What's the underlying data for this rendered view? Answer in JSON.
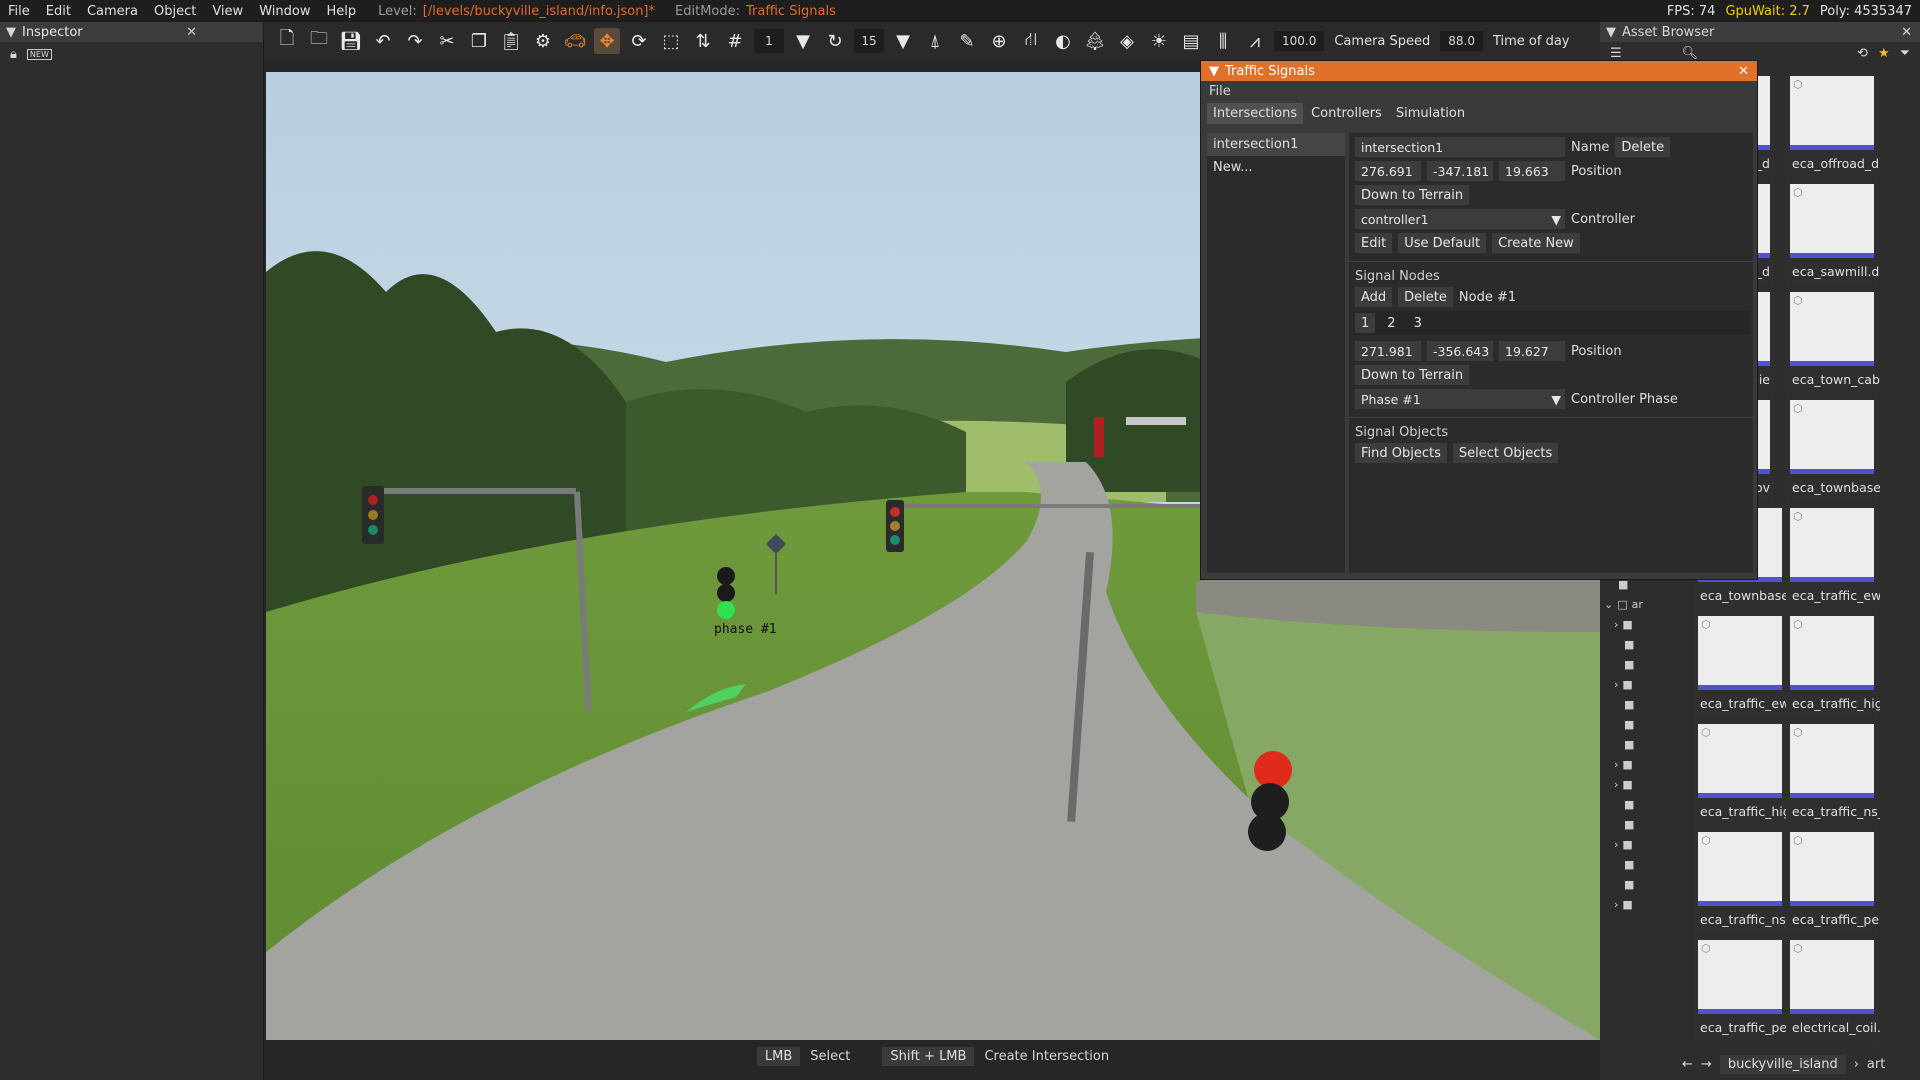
{
  "menubar": {
    "items": [
      "File",
      "Edit",
      "Camera",
      "Object",
      "View",
      "Window",
      "Help"
    ],
    "level_label": "Level:",
    "level_value": "[/levels/buckyville_island/info.json]*",
    "editmode_label": "EditMode:",
    "editmode_value": "Traffic Signals",
    "fps": "FPS: 74",
    "gpuwait": "GpuWait: 2.7",
    "poly": "Poly: 4535347"
  },
  "inspector": {
    "title": "Inspector",
    "close": "✕",
    "new_badge": "NEW"
  },
  "toolbar": {
    "grid_value": "1",
    "snap_value": "15",
    "camera_speed_value": "100.0",
    "camera_speed_label": "Camera Speed",
    "time_of_day_value": "88.0",
    "time_of_day_label": "Time of day"
  },
  "viewport": {
    "phase_label": "phase #1"
  },
  "statusbar": {
    "k1": "LMB",
    "a1": "Select",
    "k2": "Shift + LMB",
    "a2": "Create Intersection"
  },
  "traffic_signals": {
    "title": "Traffic Signals",
    "menu": "File",
    "tabs": [
      "Intersections",
      "Controllers",
      "Simulation"
    ],
    "intersections": [
      "intersection1",
      "New..."
    ],
    "name_value": "intersection1",
    "name_label": "Name",
    "delete_label": "Delete",
    "pos": [
      "276.691",
      "-347.181",
      "19.663"
    ],
    "position_label": "Position",
    "down_to_terrain": "Down to Terrain",
    "controller_value": "controller1",
    "controller_label": "Controller",
    "edit": "Edit",
    "use_default": "Use Default",
    "create_new": "Create New",
    "signal_nodes": "Signal Nodes",
    "add": "Add",
    "node_delete": "Delete",
    "node_label": "Node #1",
    "nodes": [
      "1",
      "2",
      "3"
    ],
    "node_pos": [
      "271.981",
      "-356.643",
      "19.627"
    ],
    "node_down": "Down to Terrain",
    "phase_value": "Phase #1",
    "controller_phase_label": "Controller Phase",
    "signal_objects": "Signal Objects",
    "find_objects": "Find Objects",
    "select_objects": "Select Objects"
  },
  "asset_browser": {
    "title": "Asset Browser",
    "close": "✕",
    "cards": [
      {
        "name": "eca_offroad_d"
      },
      {
        "name": "eca_sawmill.d"
      },
      {
        "name": "eca_town_cab"
      },
      {
        "name": "eca_townbase"
      },
      {
        "name": "eca_townbase"
      },
      {
        "name": "eca_traffic_ew"
      },
      {
        "name": "eca_traffic_ew"
      },
      {
        "name": "eca_traffic_hig"
      },
      {
        "name": "eca_traffic_hig"
      },
      {
        "name": "eca_traffic_ns_"
      },
      {
        "name": "eca_traffic_ns_"
      },
      {
        "name": "eca_traffic_pe"
      },
      {
        "name": "eca_traffic_pe"
      },
      {
        "name": "electrical_coil."
      }
    ],
    "partial_cards": [
      "d_d",
      "d_d",
      "pie",
      "poov"
    ],
    "tree_label": "ar",
    "breadcrumb": "buckyville_island",
    "breadcrumb2": "art"
  }
}
